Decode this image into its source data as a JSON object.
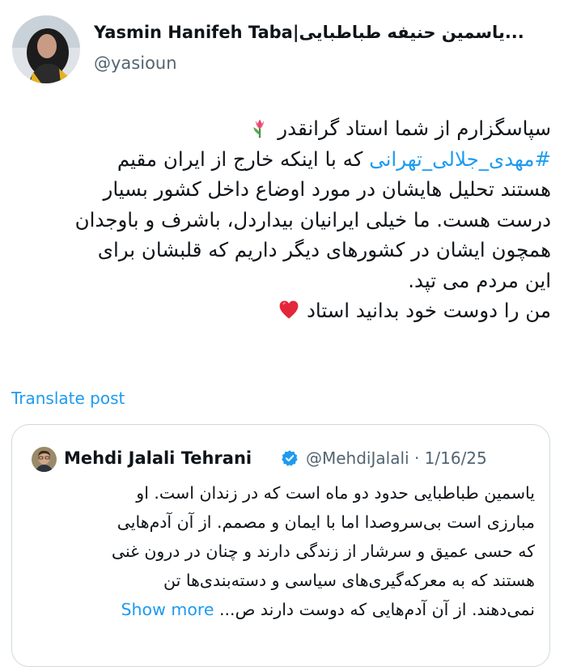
{
  "author": {
    "display_name": "Yasmin Hanifeh Taba|یاسمین حنیفه طباطبایی...",
    "handle": "@yasioun"
  },
  "tweet": {
    "lines": [
      "سپاسگزارم از شما استاد گرانقدر",
      "که با اینکه خارج از ایران مقیم",
      "هستند تحلیل هایشان در مورد اوضاع داخل کشور بسیار",
      "درست هست. ما خیلی ایرانیان بیداردل، باشرف و باوجدان",
      "همچون ایشان در کشورهای دیگر داریم که قلبشان برای",
      "این مردم می تپد.",
      "من را دوست خود بدانید استاد"
    ],
    "hashtag": "#مهدی_جلالی_تهرانی",
    "emoji_1": "tulip-emoji",
    "emoji_2": "red-heart-emoji"
  },
  "translate_label": "Translate post",
  "quote": {
    "name": "Mehdi Jalali Tehrani",
    "handle": "@MehdiJalali",
    "separator": "·",
    "date": "1/16/25",
    "lines": [
      "یاسمین طباطبایی حدود دو ماه است که در زندان است. او",
      "مبارزی است بی‌سروصدا اما با ایمان و مصمم. از آن آدم‌هایی",
      "که حسی عمیق و سرشار از زندگی دارند و چنان در درون غنی",
      "هستند که به معرکه‌گیری‌های سیاسی و دسته‌بندی‌ها تن",
      "نمی‌دهند. از آن آدم‌هایی که دوست دارند ص..."
    ],
    "show_more": "Show more",
    "verified_icon": "verified-badge-icon",
    "verified_color": "#1d9bf0"
  },
  "colors": {
    "link": "#1d9bf0",
    "secondary_text": "#536471",
    "border": "#cfd9de"
  }
}
